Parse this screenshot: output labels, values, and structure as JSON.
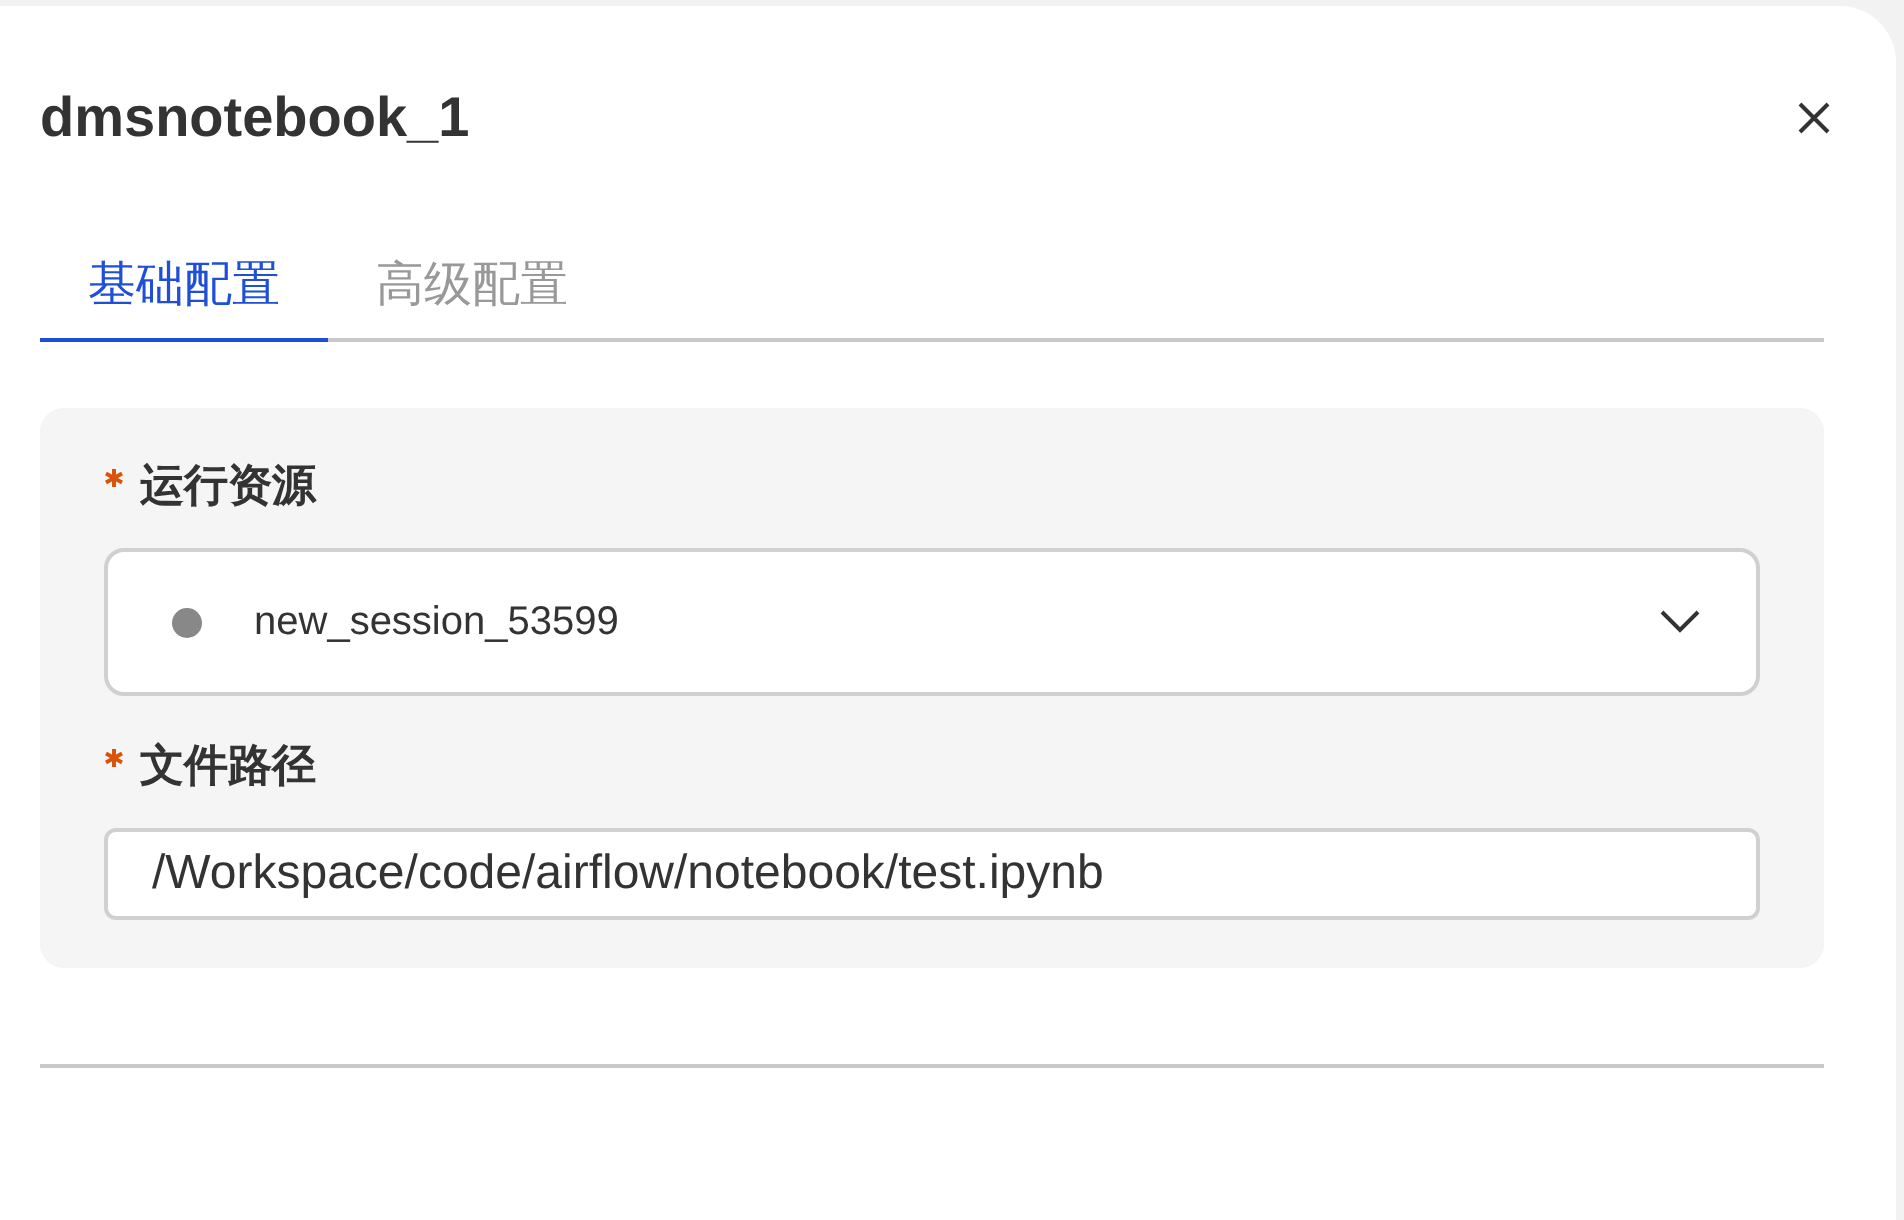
{
  "dialog": {
    "title": "dmsnotebook_1"
  },
  "tabs": [
    {
      "label": "基础配置",
      "selected": true
    },
    {
      "label": "高级配置",
      "selected": false
    }
  ],
  "fields": [
    {
      "kind": "select",
      "label": "运行资源",
      "required": true,
      "value": "new_session_53599"
    },
    {
      "kind": "text",
      "label": "文件路径",
      "required": true,
      "value": "/Workspace/code/airflow/notebook/test.ipynb"
    }
  ]
}
